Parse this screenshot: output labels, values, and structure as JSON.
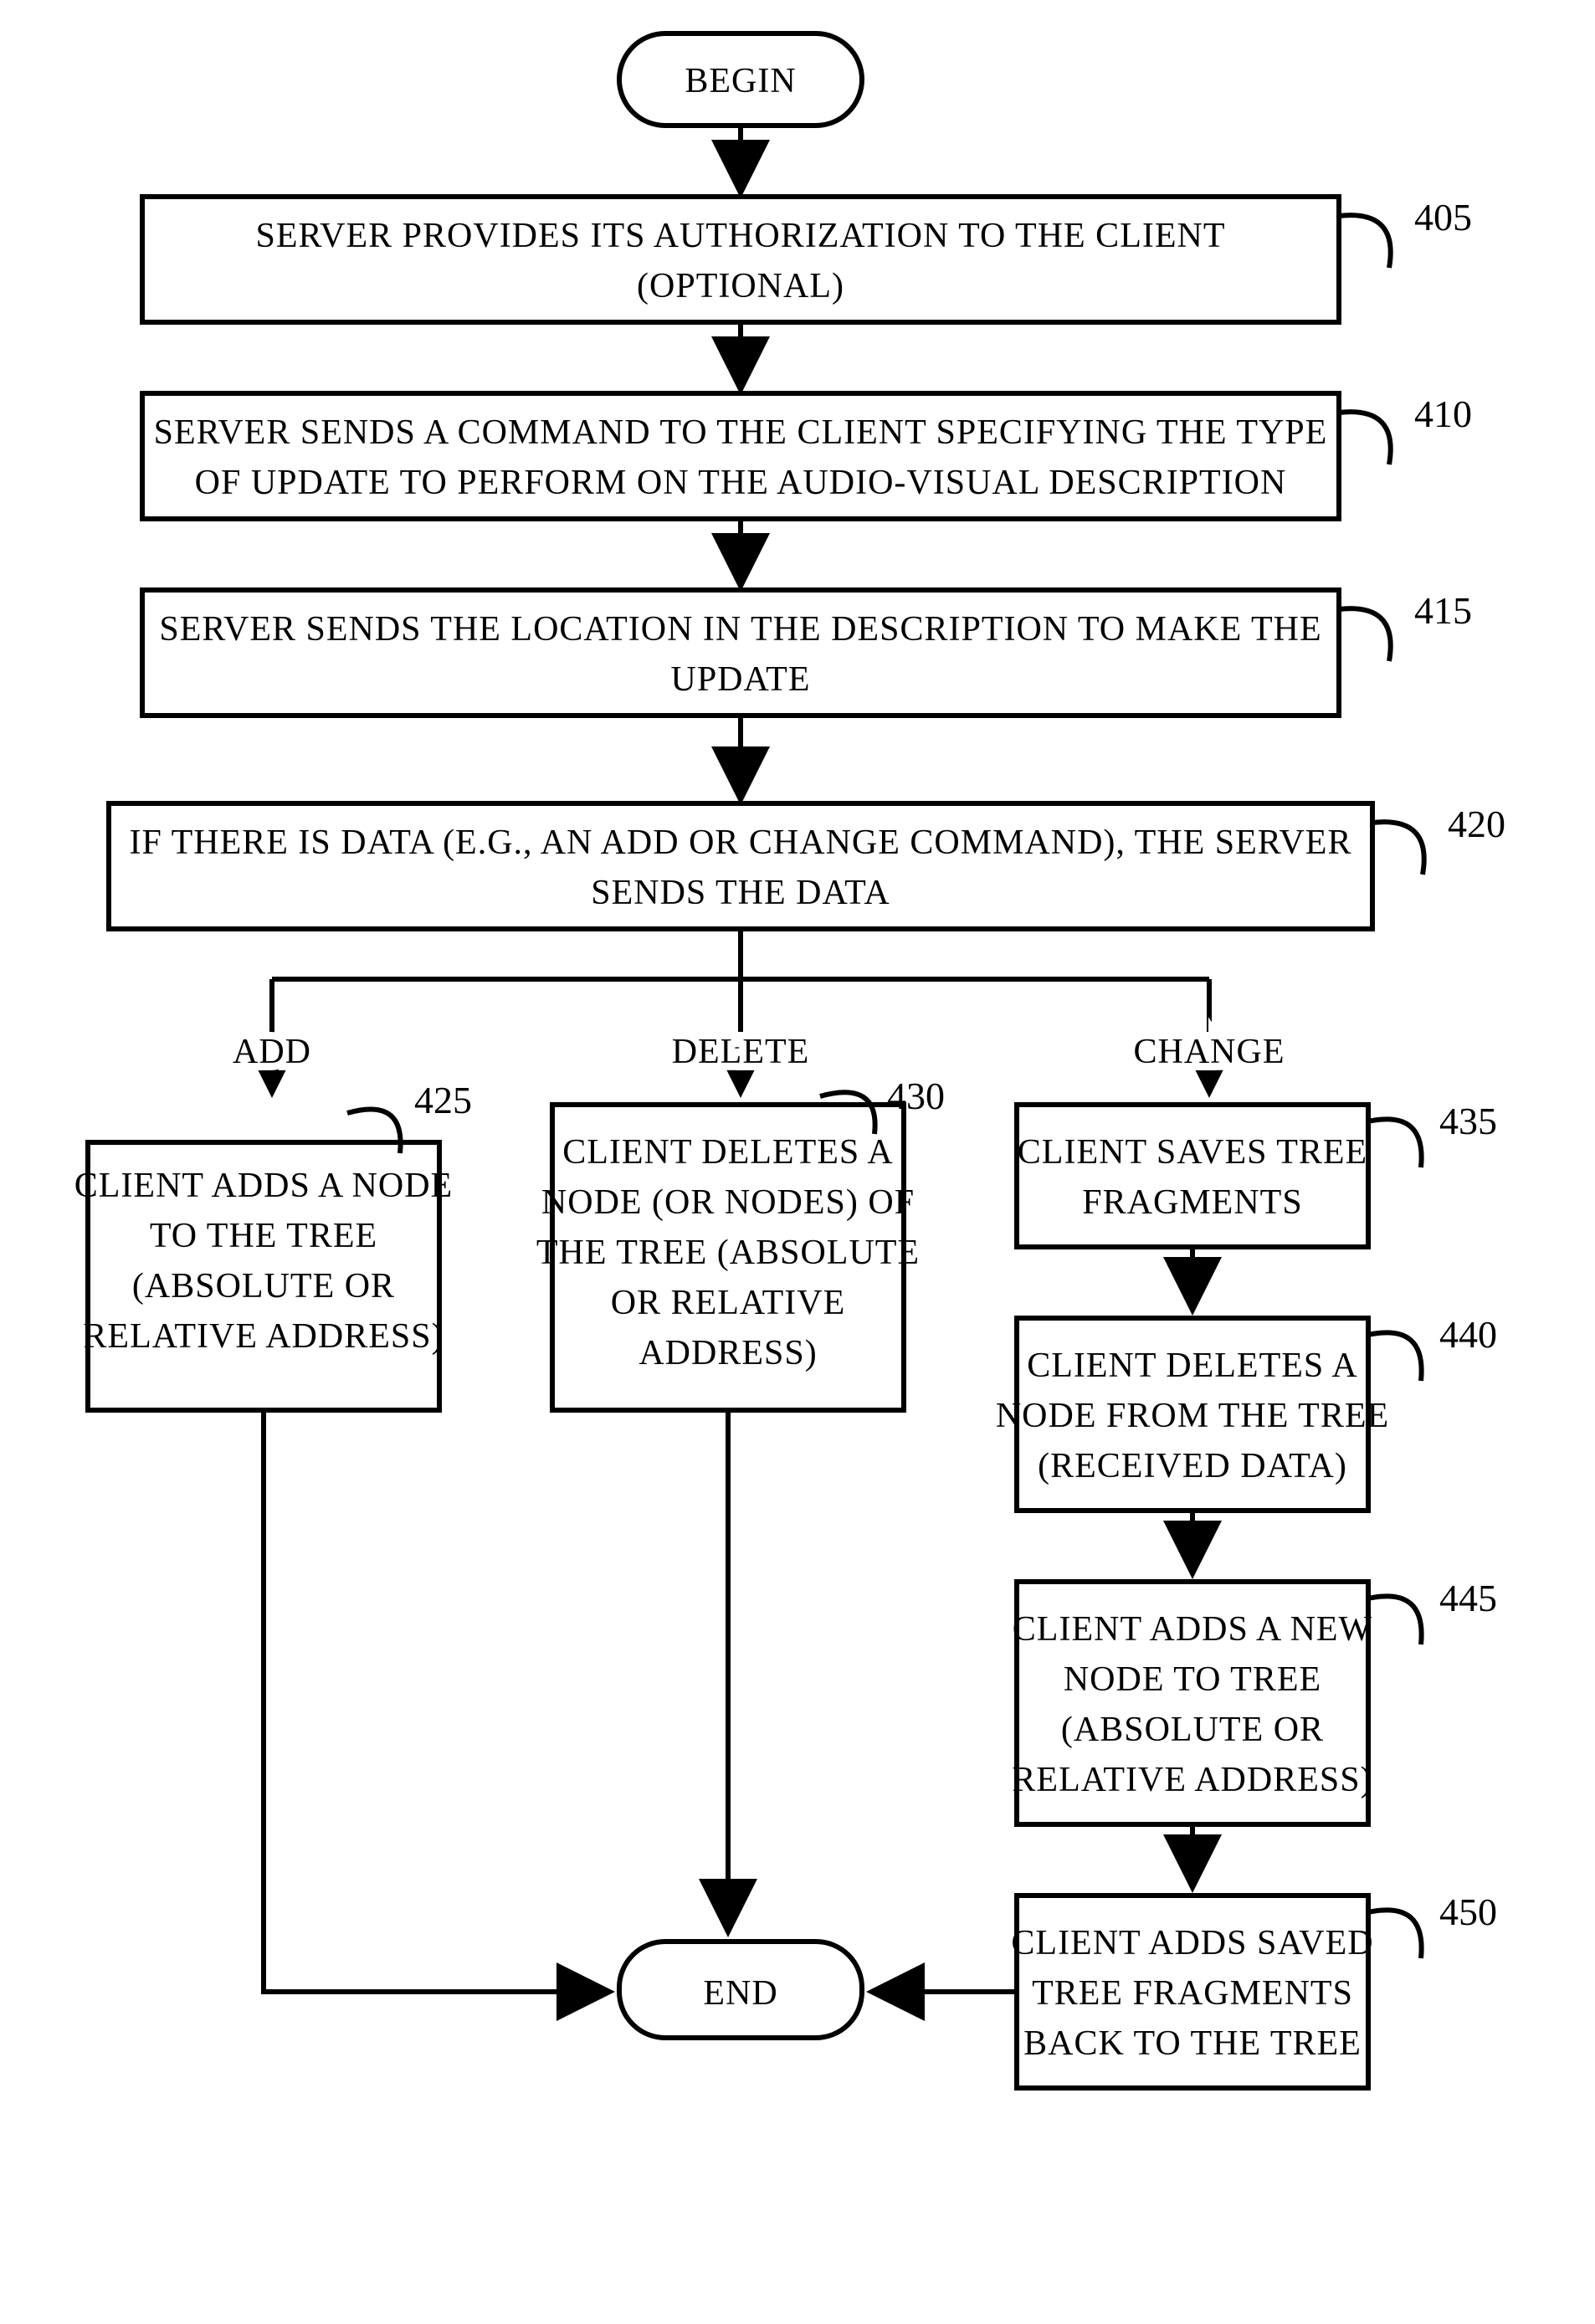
{
  "terminal": {
    "begin": "BEGIN",
    "end": "END"
  },
  "steps": {
    "s405": {
      "num": "405",
      "l1": "SERVER PROVIDES ITS AUTHORIZATION TO THE CLIENT",
      "l2": "(OPTIONAL)"
    },
    "s410": {
      "num": "410",
      "l1": "SERVER SENDS A COMMAND TO THE CLIENT SPECIFYING THE TYPE",
      "l2": "OF UPDATE TO PERFORM ON THE AUDIO-VISUAL DESCRIPTION"
    },
    "s415": {
      "num": "415",
      "l1": "SERVER SENDS THE LOCATION IN THE DESCRIPTION TO MAKE THE",
      "l2": "UPDATE"
    },
    "s420": {
      "num": "420",
      "l1": "IF THERE IS DATA (E.G., AN ADD OR CHANGE COMMAND), THE SERVER",
      "l2": "SENDS THE DATA"
    },
    "s425": {
      "num": "425",
      "l1": "CLIENT ADDS A NODE",
      "l2": "TO THE TREE",
      "l3": "(ABSOLUTE OR",
      "l4": "RELATIVE ADDRESS)"
    },
    "s430": {
      "num": "430",
      "l1": "CLIENT DELETES A",
      "l2": "NODE (OR NODES) OF",
      "l3": "THE TREE (ABSOLUTE",
      "l4": "OR RELATIVE",
      "l5": "ADDRESS)"
    },
    "s435": {
      "num": "435",
      "l1": "CLIENT SAVES TREE",
      "l2": "FRAGMENTS"
    },
    "s440": {
      "num": "440",
      "l1": "CLIENT DELETES A",
      "l2": "NODE FROM THE TREE",
      "l3": "(RECEIVED DATA)"
    },
    "s445": {
      "num": "445",
      "l1": "CLIENT ADDS A NEW",
      "l2": "NODE TO TREE",
      "l3": "(ABSOLUTE OR",
      "l4": "RELATIVE ADDRESS)"
    },
    "s450": {
      "num": "450",
      "l1": "CLIENT ADDS SAVED",
      "l2": "TREE FRAGMENTS",
      "l3": "BACK TO THE TREE"
    }
  },
  "branches": {
    "add": "ADD",
    "delete": "DELETE",
    "change": "CHANGE"
  }
}
